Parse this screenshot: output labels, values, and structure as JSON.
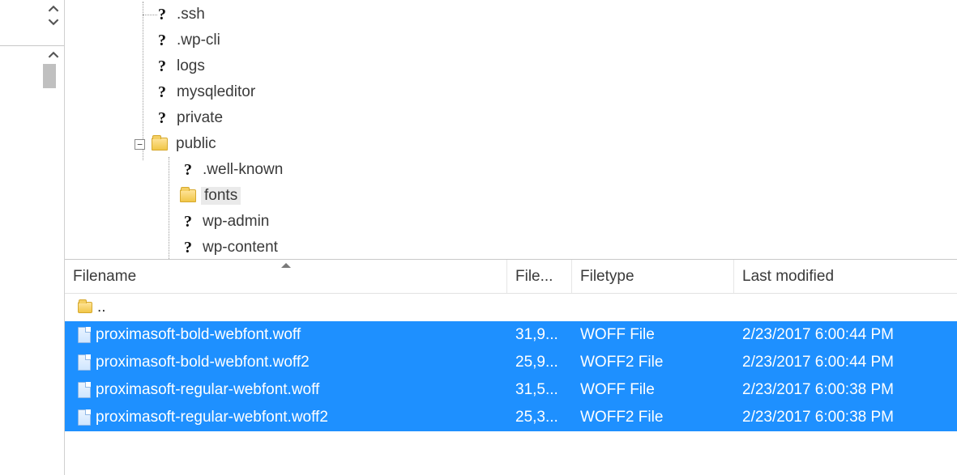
{
  "tree": {
    "items": [
      {
        "name": ".ssh",
        "icon": "question"
      },
      {
        "name": ".wp-cli",
        "icon": "question"
      },
      {
        "name": "logs",
        "icon": "question"
      },
      {
        "name": "mysqleditor",
        "icon": "question"
      },
      {
        "name": "private",
        "icon": "question"
      },
      {
        "name": "public",
        "icon": "folder",
        "expanded": true,
        "children": [
          {
            "name": ".well-known",
            "icon": "question"
          },
          {
            "name": "fonts",
            "icon": "folder",
            "selected": true
          },
          {
            "name": "wp-admin",
            "icon": "question"
          },
          {
            "name": "wp-content",
            "icon": "question"
          }
        ]
      }
    ],
    "expander_minus": "−"
  },
  "list": {
    "headers": {
      "filename": "Filename",
      "filesize": "File...",
      "filetype": "Filetype",
      "lastmod": "Last modified"
    },
    "updir": "..",
    "rows": [
      {
        "name": "proximasoft-bold-webfont.woff",
        "size": "31,9...",
        "type": "WOFF File",
        "mod": "2/23/2017 6:00:44 PM",
        "selected": true
      },
      {
        "name": "proximasoft-bold-webfont.woff2",
        "size": "25,9...",
        "type": "WOFF2 File",
        "mod": "2/23/2017 6:00:44 PM",
        "selected": true
      },
      {
        "name": "proximasoft-regular-webfont.woff",
        "size": "31,5...",
        "type": "WOFF File",
        "mod": "2/23/2017 6:00:38 PM",
        "selected": true
      },
      {
        "name": "proximasoft-regular-webfont.woff2",
        "size": "25,3...",
        "type": "WOFF2 File",
        "mod": "2/23/2017 6:00:38 PM",
        "selected": true
      }
    ]
  }
}
